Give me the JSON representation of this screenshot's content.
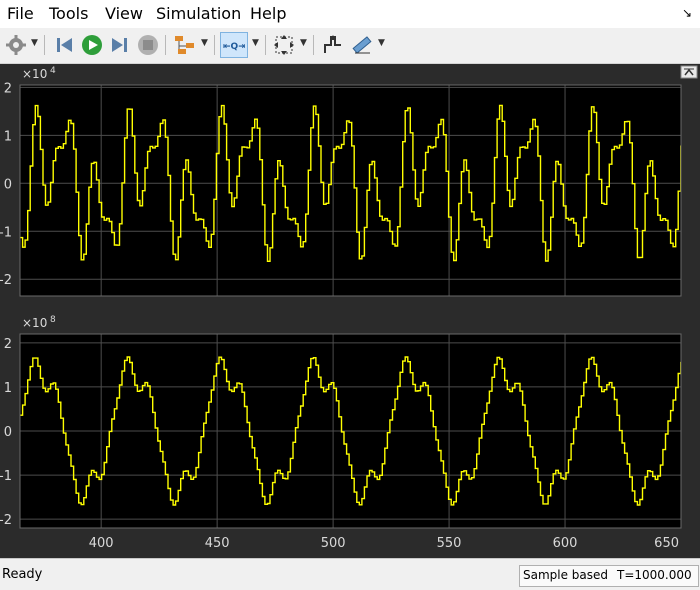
{
  "menu": [
    "File",
    "Tools",
    "View",
    "Simulation",
    "Help"
  ],
  "toolbar": {
    "icons": [
      "gear-icon",
      "step-back-icon",
      "run-icon",
      "step-forward-icon",
      "stop-icon",
      "signal-hierarchy-icon",
      "zoom-icon",
      "fit-to-view-icon",
      "cursor-measure-icon",
      "triggers-icon"
    ]
  },
  "colors": {
    "background": "#000000",
    "grid": "#4d4d4d",
    "signal": "#ffff00",
    "axis_text": "#d9d9d9"
  },
  "chart_data": [
    {
      "type": "line",
      "title": "",
      "exponent_label": "×10",
      "exponent_power": "4",
      "xlim": [
        365,
        650
      ],
      "ylim": [
        -2.35,
        2.05
      ],
      "yticks": [
        -2,
        -1,
        0,
        1,
        2
      ],
      "ytick_labels": [
        "-2",
        "-1",
        "0",
        "1",
        "2"
      ],
      "scale": 10000,
      "grid": true,
      "series": [
        {
          "shape": "ac-harmonic",
          "period": 40,
          "phase": 370,
          "amplitude": 2,
          "x": [
            365,
            367,
            369,
            371,
            373,
            375,
            377,
            379,
            381,
            383,
            385,
            387,
            389,
            391,
            393,
            395,
            397,
            399,
            401,
            403,
            405,
            407,
            409
          ],
          "y": [
            1.4,
            1.0,
            0.2,
            0.0,
            0.6,
            1.6,
            1.9,
            1.7,
            1.2,
            0.3,
            -0.3,
            -0.1,
            0.6,
            0.4,
            -0.4,
            -1.3,
            -1.8,
            -1.9,
            -1.4,
            -0.8,
            -0.2,
            -0.5,
            -1.2
          ]
        }
      ]
    },
    {
      "type": "line",
      "title": "",
      "exponent_label": "×10",
      "exponent_power": "8",
      "xlim": [
        365,
        650
      ],
      "ylim": [
        -2.2,
        2.2
      ],
      "yticks": [
        -2,
        -1,
        0,
        1,
        2
      ],
      "ytick_labels": [
        "-2",
        "-1",
        "0",
        "1",
        "2"
      ],
      "x_ticks": [
        400,
        450,
        500,
        550,
        600,
        650
      ],
      "x_tick_labels": [
        "400",
        "450",
        "500",
        "550",
        "600",
        "650"
      ],
      "scale": 100000000,
      "grid": true,
      "series": [
        {
          "shape": "integrated-harmonic",
          "period": 40,
          "phase": 370,
          "amplitude": 2,
          "x": [
            365,
            370,
            375,
            380,
            385,
            390,
            395,
            400,
            405,
            410,
            415,
            420,
            425,
            430,
            435,
            440,
            445,
            450
          ],
          "y": [
            -1.3,
            -1.5,
            -1.9,
            -0.8,
            0.3,
            1.6,
            2.0,
            1.1,
            -0.4,
            -1.5,
            -1.8,
            -2.0,
            -1.3,
            -0.5,
            0.2,
            0.8,
            1.4,
            2.0
          ]
        }
      ]
    }
  ],
  "status": {
    "ready": "Ready",
    "sample_based": "Sample based",
    "time": "T=1000.000"
  }
}
